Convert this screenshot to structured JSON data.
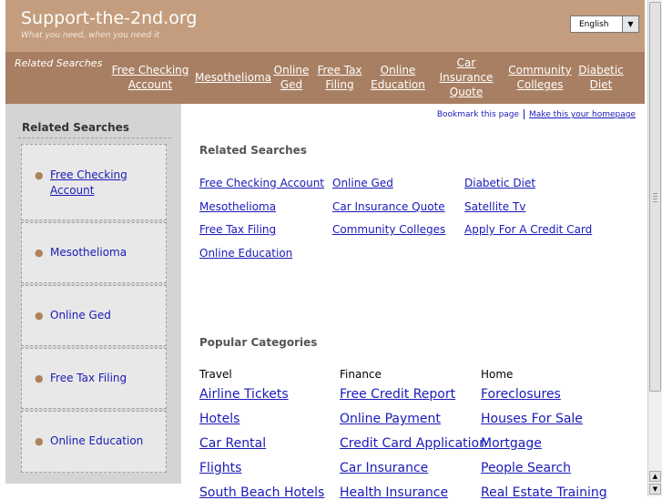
{
  "header": {
    "site_title": "Support-the-2nd.org",
    "tagline": "What you need, when you need it",
    "language": "English"
  },
  "nav": {
    "label": "Related Searches",
    "items": [
      {
        "line1": "Free Checking",
        "line2": "Account"
      },
      {
        "line1": "Mesothelioma",
        "line2": ""
      },
      {
        "line1": "Online",
        "line2": "Ged"
      },
      {
        "line1": "Free Tax",
        "line2": "Filing"
      },
      {
        "line1": "Online",
        "line2": "Education"
      },
      {
        "line1": "Car",
        "line2": "Insurance",
        "line3": "Quote"
      },
      {
        "line1": "Community",
        "line2": "Colleges"
      },
      {
        "line1": "Diabetic",
        "line2": "Diet"
      }
    ]
  },
  "sidebar": {
    "title": "Related Searches",
    "items": [
      {
        "label": "Free Checking Account"
      },
      {
        "label": "Mesothelioma"
      },
      {
        "label": "Online Ged"
      },
      {
        "label": "Free Tax Filing"
      },
      {
        "label": "Online Education"
      }
    ]
  },
  "bookmarks": {
    "bookmark": "Bookmark this page",
    "homepage": "Make this your homepage"
  },
  "related": {
    "title": "Related Searches",
    "links": [
      "Free Checking Account",
      "Online Ged",
      "Diabetic Diet",
      "Mesothelioma",
      "Car Insurance Quote",
      "Satellite Tv",
      "Free Tax Filing",
      "Community Colleges",
      "Apply For A Credit Card",
      "Online Education"
    ]
  },
  "popular": {
    "title": "Popular Categories",
    "columns": [
      {
        "heading": "Travel",
        "links": [
          "Airline Tickets",
          "Hotels",
          "Car Rental",
          "Flights",
          "South Beach Hotels"
        ]
      },
      {
        "heading": "Finance",
        "links": [
          "Free Credit Report",
          "Online Payment",
          "Credit Card Application",
          "Car Insurance",
          "Health Insurance"
        ]
      },
      {
        "heading": "Home",
        "links": [
          "Foreclosures",
          "Houses For Sale",
          "Mortgage",
          "People Search",
          "Real Estate Training"
        ]
      }
    ]
  },
  "colors": {
    "header_bg": "#c39d7d",
    "nav_bg": "#a87f62",
    "sidebar_bg": "#d4d4d4",
    "link": "#1a1ab8"
  },
  "icons": {
    "dropdown": "chevron-down-icon",
    "scroll_up": "arrow-up-icon",
    "scroll_down": "arrow-down-icon"
  }
}
